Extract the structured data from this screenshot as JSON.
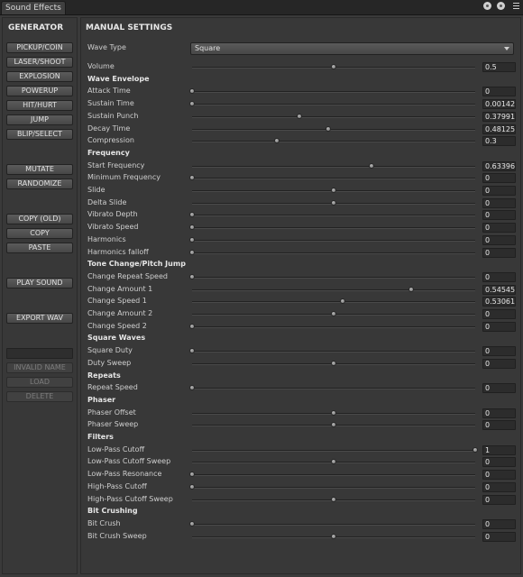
{
  "window": {
    "tab_title": "Sound Effects"
  },
  "generator": {
    "title": "GENERATOR",
    "presets": [
      "PICKUP/COIN",
      "LASER/SHOOT",
      "EXPLOSION",
      "POWERUP",
      "HIT/HURT",
      "JUMP",
      "BLIP/SELECT"
    ],
    "mutate": "MUTATE",
    "randomize": "RANDOMIZE",
    "copy_old": "COPY (OLD)",
    "copy": "COPY",
    "paste": "PASTE",
    "play_sound": "PLAY SOUND",
    "export_wav": "EXPORT WAV",
    "name_value": "",
    "invalid_name": "INVALID NAME",
    "load": "LOAD",
    "delete": "DELETE"
  },
  "manual": {
    "title": "MANUAL SETTINGS",
    "wave_type_label": "Wave Type",
    "wave_type_value": "Square",
    "rows": [
      {
        "type": "param",
        "name": "volume",
        "label": "Volume",
        "value": "0.5",
        "fraction": 0.5
      },
      {
        "type": "group",
        "label": "Wave Envelope"
      },
      {
        "type": "param",
        "name": "attack-time",
        "label": "Attack Time",
        "value": "0",
        "fraction": 0
      },
      {
        "type": "param",
        "name": "sustain-time",
        "label": "Sustain Time",
        "value": "0.00142",
        "fraction": 0.0
      },
      {
        "type": "param",
        "name": "sustain-punch",
        "label": "Sustain Punch",
        "value": "0.37991",
        "fraction": 0.38
      },
      {
        "type": "param",
        "name": "decay-time",
        "label": "Decay Time",
        "value": "0.48125",
        "fraction": 0.48
      },
      {
        "type": "param",
        "name": "compression",
        "label": "Compression",
        "value": "0.3",
        "fraction": 0.3
      },
      {
        "type": "group",
        "label": "Frequency"
      },
      {
        "type": "param",
        "name": "start-frequency",
        "label": "Start Frequency",
        "value": "0.63396",
        "fraction": 0.634
      },
      {
        "type": "param",
        "name": "minimum-frequency",
        "label": "Minimum Frequency",
        "value": "0",
        "fraction": 0
      },
      {
        "type": "param",
        "name": "slide",
        "label": "Slide",
        "value": "0",
        "fraction": 0.5
      },
      {
        "type": "param",
        "name": "delta-slide",
        "label": "Delta Slide",
        "value": "0",
        "fraction": 0.5
      },
      {
        "type": "param",
        "name": "vibrato-depth",
        "label": "Vibrato Depth",
        "value": "0",
        "fraction": 0
      },
      {
        "type": "param",
        "name": "vibrato-speed",
        "label": "Vibrato Speed",
        "value": "0",
        "fraction": 0
      },
      {
        "type": "param",
        "name": "harmonics",
        "label": "Harmonics",
        "value": "0",
        "fraction": 0
      },
      {
        "type": "param",
        "name": "harmonics-falloff",
        "label": "Harmonics falloff",
        "value": "0",
        "fraction": 0
      },
      {
        "type": "group",
        "label": "Tone Change/Pitch Jump"
      },
      {
        "type": "param",
        "name": "change-repeat-speed",
        "label": "Change Repeat Speed",
        "value": "0",
        "fraction": 0
      },
      {
        "type": "param",
        "name": "change-amount-1",
        "label": "Change Amount 1",
        "value": "0.54545",
        "fraction": 0.773
      },
      {
        "type": "param",
        "name": "change-speed-1",
        "label": "Change Speed 1",
        "value": "0.53061",
        "fraction": 0.531
      },
      {
        "type": "param",
        "name": "change-amount-2",
        "label": "Change Amount 2",
        "value": "0",
        "fraction": 0.5
      },
      {
        "type": "param",
        "name": "change-speed-2",
        "label": "Change Speed 2",
        "value": "0",
        "fraction": 0
      },
      {
        "type": "group",
        "label": "Square Waves"
      },
      {
        "type": "param",
        "name": "square-duty",
        "label": "Square Duty",
        "value": "0",
        "fraction": 0
      },
      {
        "type": "param",
        "name": "duty-sweep",
        "label": "Duty Sweep",
        "value": "0",
        "fraction": 0.5
      },
      {
        "type": "group",
        "label": "Repeats"
      },
      {
        "type": "param",
        "name": "repeat-speed",
        "label": "Repeat Speed",
        "value": "0",
        "fraction": 0
      },
      {
        "type": "group",
        "label": "Phaser"
      },
      {
        "type": "param",
        "name": "phaser-offset",
        "label": "Phaser Offset",
        "value": "0",
        "fraction": 0.5
      },
      {
        "type": "param",
        "name": "phaser-sweep",
        "label": "Phaser Sweep",
        "value": "0",
        "fraction": 0.5
      },
      {
        "type": "group",
        "label": "Filters"
      },
      {
        "type": "param",
        "name": "low-pass-cutoff",
        "label": "Low-Pass Cutoff",
        "value": "1",
        "fraction": 1
      },
      {
        "type": "param",
        "name": "low-pass-cutoff-sweep",
        "label": "Low-Pass Cutoff Sweep",
        "value": "0",
        "fraction": 0.5
      },
      {
        "type": "param",
        "name": "low-pass-resonance",
        "label": "Low-Pass Resonance",
        "value": "0",
        "fraction": 0
      },
      {
        "type": "param",
        "name": "high-pass-cutoff",
        "label": "High-Pass Cutoff",
        "value": "0",
        "fraction": 0
      },
      {
        "type": "param",
        "name": "high-pass-cutoff-sweep",
        "label": "High-Pass Cutoff Sweep",
        "value": "0",
        "fraction": 0.5
      },
      {
        "type": "group",
        "label": "Bit Crushing"
      },
      {
        "type": "param",
        "name": "bit-crush",
        "label": "Bit Crush",
        "value": "0",
        "fraction": 0
      },
      {
        "type": "param",
        "name": "bit-crush-sweep",
        "label": "Bit Crush Sweep",
        "value": "0",
        "fraction": 0.5
      }
    ]
  }
}
